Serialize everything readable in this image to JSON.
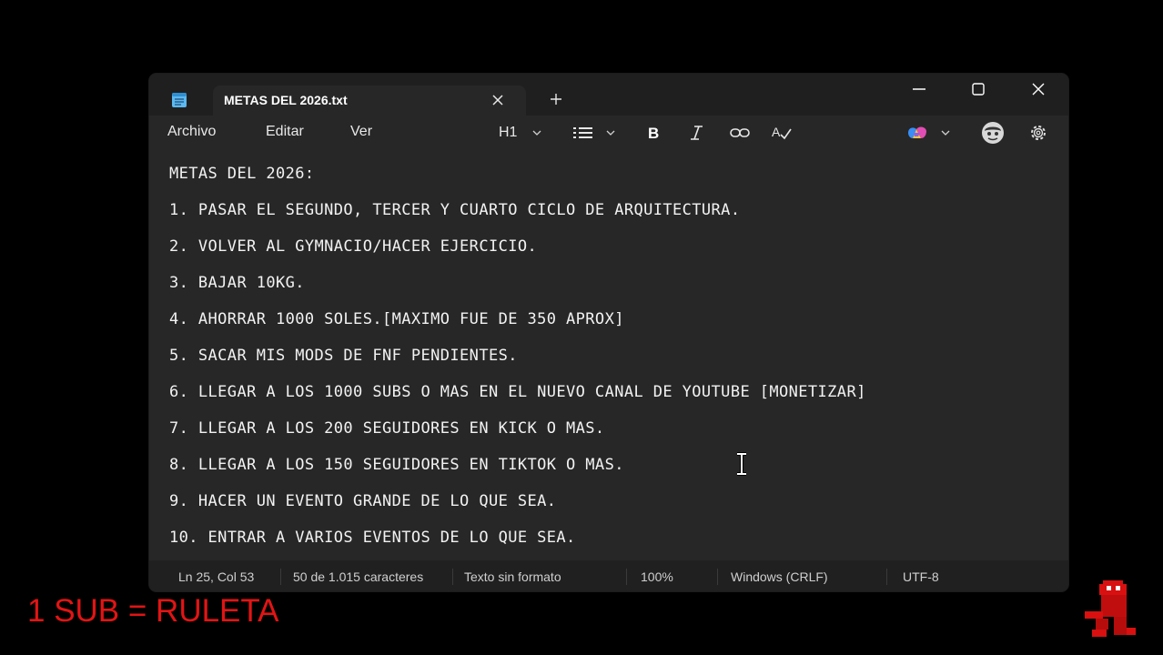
{
  "window": {
    "tab_title": "METAS DEL 2026.txt",
    "icons": {
      "app": "notepad-icon",
      "tab_close": "close-icon",
      "new_tab": "plus-icon",
      "minimize": "minimize-icon",
      "maximize": "maximize-icon",
      "close": "close-icon"
    }
  },
  "menu": {
    "items": [
      "Archivo",
      "Editar",
      "Ver"
    ]
  },
  "toolbar": {
    "heading_label": "H1",
    "icons": [
      "chevron-down-icon",
      "list-icon",
      "chevron-down-icon",
      "bold-icon",
      "italic-icon",
      "link-icon",
      "clear-format-icon",
      "copilot-icon",
      "chevron-down-icon",
      "account-icon",
      "settings-icon"
    ]
  },
  "editor": {
    "lines": [
      "METAS DEL 2026:",
      "1. PASAR EL SEGUNDO, TERCER Y CUARTO CICLO DE ARQUITECTURA.",
      "2. VOLVER AL GYMNACIO/HACER EJERCICIO.",
      "3. BAJAR 10KG.",
      "4. AHORRAR 1000 SOLES.[MAXIMO FUE DE 350 APROX]",
      "5. SACAR MIS MODS DE FNF PENDIENTES.",
      "6. LLEGAR A LOS 1000 SUBS O MAS EN EL NUEVO CANAL DE YOUTUBE [MONETIZAR]",
      "7. LLEGAR A LOS 200 SEGUIDORES EN KICK O MAS.",
      "8. LLEGAR A LOS 150 SEGUIDORES EN TIKTOK O MAS.",
      "9. HACER UN EVENTO GRANDE DE LO QUE SEA.",
      "10. ENTRAR A VARIOS EVENTOS DE LO QUE SEA."
    ]
  },
  "status": {
    "position": "Ln 25, Col 53",
    "chars": "50 de 1.015 caracteres",
    "format": "Texto sin formato",
    "zoom": "100%",
    "line_ending": "Windows (CRLF)",
    "encoding": "UTF-8"
  },
  "overlay": {
    "caption": "1 SUB = RULETA",
    "caption_color": "#e21414"
  },
  "colors": {
    "window_bg": "#272727",
    "titlebar_bg": "#1f1f1f",
    "statusbar_bg": "#202020",
    "text": "#f2f2f2"
  }
}
